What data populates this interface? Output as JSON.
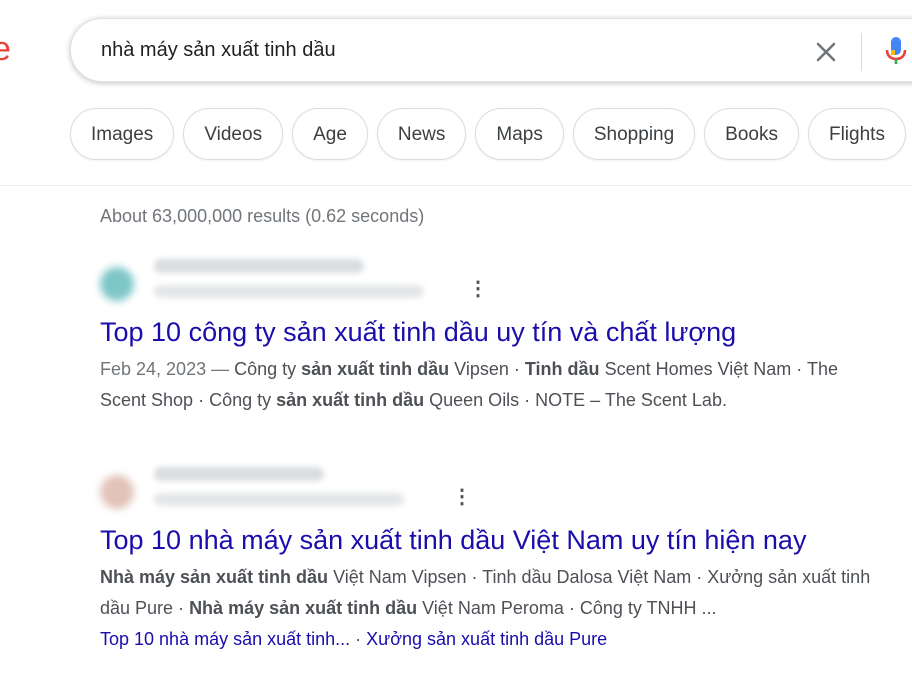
{
  "logo_fragment": "e",
  "search": {
    "query": "nhà máy sản xuất tinh dầu"
  },
  "chips": [
    "Images",
    "Videos",
    "Age",
    "News",
    "Maps",
    "Shopping",
    "Books",
    "Flights"
  ],
  "stats": "About 63,000,000 results (0.62 seconds)",
  "colors": {
    "link": "#1a0dab",
    "snippet": "#4d5156",
    "meta": "#70757a",
    "accent_red": "#ea4335"
  },
  "results": [
    {
      "title": "Top 10 công ty sản xuất tinh dầu uy tín và chất lượng",
      "snippet_line1": [
        {
          "t": "Feb 24, 2023 — ",
          "style": "date"
        },
        {
          "t": "Công ty ",
          "style": ""
        },
        {
          "t": "sản xuất tinh dầu",
          "style": "b"
        },
        {
          "t": " Vipsen · ",
          "style": ""
        },
        {
          "t": "Tinh dầu",
          "style": "b"
        },
        {
          "t": " Scent Homes Việt Nam · The",
          "style": ""
        }
      ],
      "snippet_line2": [
        {
          "t": "Scent Shop · Công ty ",
          "style": ""
        },
        {
          "t": "sản xuất tinh dầu",
          "style": "b"
        },
        {
          "t": " Queen Oils · NOTE – The Scent Lab.",
          "style": ""
        }
      ]
    },
    {
      "title": "Top 10 nhà máy sản xuất tinh dầu Việt Nam uy tín hiện nay",
      "snippet_line1": [
        {
          "t": "Nhà máy sản xuất tinh dầu",
          "style": "b"
        },
        {
          "t": " Việt Nam Vipsen · Tinh dầu Dalosa Việt Nam · Xưởng sản xuất tinh",
          "style": ""
        }
      ],
      "snippet_line2": [
        {
          "t": "dầu Pure · ",
          "style": ""
        },
        {
          "t": "Nhà máy sản xuất tinh dầu",
          "style": "b"
        },
        {
          "t": " Việt Nam Peroma · Công ty TNHH ...",
          "style": ""
        }
      ],
      "sublinks": [
        "Top 10 nhà máy sản xuất tinh...",
        "Xưởng sản xuất tinh dầu Pure"
      ],
      "sublink_separator": " · "
    }
  ]
}
